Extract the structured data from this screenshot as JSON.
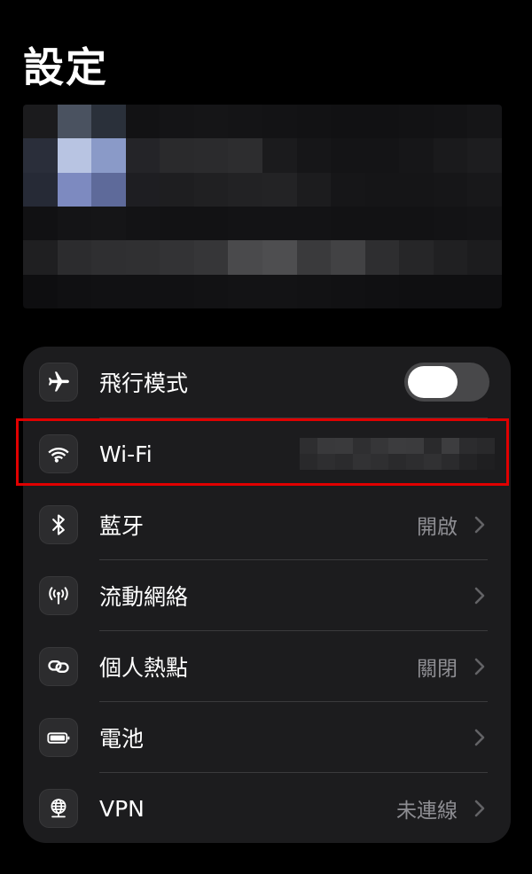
{
  "page": {
    "title": "設定"
  },
  "settings": {
    "airplane": {
      "label": "飛行模式",
      "toggle_on": false
    },
    "wifi": {
      "label": "Wi-Fi"
    },
    "bluetooth": {
      "label": "藍牙",
      "value": "開啟"
    },
    "cellular": {
      "label": "流動網絡"
    },
    "hotspot": {
      "label": "個人熱點",
      "value": "關閉"
    },
    "battery": {
      "label": "電池"
    },
    "vpn": {
      "label": "VPN",
      "value": "未連線"
    }
  },
  "colors": {
    "highlight": "#e00000",
    "card_bg": "#1c1c1e",
    "secondary_text": "#8e8e93"
  },
  "icons": [
    "airplane-icon",
    "wifi-icon",
    "bluetooth-icon",
    "cellular-icon",
    "hotspot-icon",
    "battery-icon",
    "vpn-icon",
    "chevron-right-icon"
  ]
}
